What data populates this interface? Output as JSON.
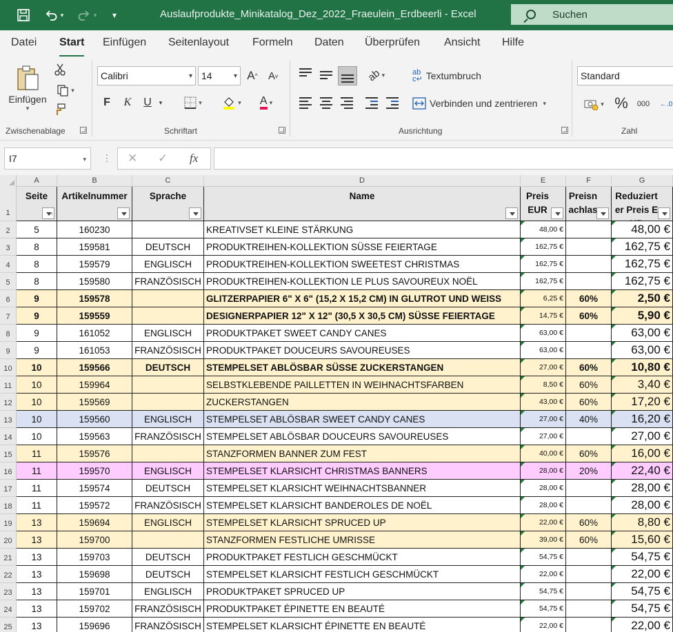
{
  "window": {
    "title": "Auslaufprodukte_Minikatalog_Dez_2022_Fraeulein_Erdbeerli  -  Excel",
    "search_label": "Suchen"
  },
  "menu": {
    "tabs": [
      "Datei",
      "Start",
      "Einfügen",
      "Seitenlayout",
      "Formeln",
      "Daten",
      "Überprüfen",
      "Ansicht",
      "Hilfe"
    ],
    "active": "Start"
  },
  "ribbon": {
    "clipboard": {
      "paste_label": "Einfügen",
      "group_label": "Zwischenablage"
    },
    "font": {
      "name": "Calibri",
      "size": "14",
      "bold": "F",
      "italic": "K",
      "underline": "U",
      "group_label": "Schriftart"
    },
    "alignment": {
      "wrap_label": "Textumbruch",
      "merge_label": "Verbinden und zentrieren",
      "group_label": "Ausrichtung"
    },
    "number": {
      "format": "Standard",
      "percent": "%",
      "thousands": "000",
      "group_label": "Zahl"
    }
  },
  "formula_bar": {
    "name_box": "I7",
    "fx": "fx",
    "formula": ""
  },
  "colors": {
    "excel_green": "#217346",
    "row_orange": "#fff2cc",
    "row_blue": "#d9e1f2",
    "row_pink": "#ffccff",
    "header_grey": "#e7e6e6"
  },
  "sheet": {
    "columns": [
      "A",
      "B",
      "C",
      "D",
      "E",
      "F",
      "G"
    ],
    "headers": {
      "seite": "Seite",
      "artikelnummer": "Artikelnummer",
      "sprache": "Sprache",
      "name": "Name",
      "preis": "Preis EUR",
      "preisnachlass": "Preisnachlass",
      "reduziert": "Reduzierter Preis EUR"
    },
    "rows": [
      {
        "row": "2",
        "seite": "5",
        "artikel": "160230",
        "sprache": "",
        "name": "KREATIVSET KLEINE STÄRKUNG",
        "preis": "48,00 €",
        "nachlass": "",
        "reduziert": "48,00 €",
        "hl": "",
        "bold": false
      },
      {
        "row": "3",
        "seite": "8",
        "artikel": "159581",
        "sprache": "DEUTSCH",
        "name": "PRODUKTREIHEN-KOLLEKTION SÜSSE FEIERTAGE",
        "preis": "162,75 €",
        "nachlass": "",
        "reduziert": "162,75 €",
        "hl": "",
        "bold": false
      },
      {
        "row": "4",
        "seite": "8",
        "artikel": "159579",
        "sprache": "ENGLISCH",
        "name": "PRODUKTREIHEN-KOLLEKTION SWEETEST CHRISTMAS",
        "preis": "162,75 €",
        "nachlass": "",
        "reduziert": "162,75 €",
        "hl": "",
        "bold": false
      },
      {
        "row": "5",
        "seite": "8",
        "artikel": "159580",
        "sprache": "FRANZÖSISCH",
        "name": "PRODUKTREIHEN-KOLLEKTION LE PLUS SAVOUREUX NOËL",
        "preis": "162,75 €",
        "nachlass": "",
        "reduziert": "162,75 €",
        "hl": "",
        "bold": false
      },
      {
        "row": "6",
        "seite": "9",
        "artikel": "159578",
        "sprache": "",
        "name": "GLITZERPAPIER 6\" X 6\" (15,2 X 15,2 CM) IN GLUTROT UND WEISS",
        "preis": "6,25 €",
        "nachlass": "60%",
        "reduziert": "2,50 €",
        "hl": "orange",
        "bold": true
      },
      {
        "row": "7",
        "seite": "9",
        "artikel": "159559",
        "sprache": "",
        "name": "DESIGNERPAPIER 12\" X 12\" (30,5 X 30,5 CM) SÜSSE FEIERTAGE",
        "preis": "14,75 €",
        "nachlass": "60%",
        "reduziert": "5,90 €",
        "hl": "orange",
        "bold": true
      },
      {
        "row": "8",
        "seite": "9",
        "artikel": "161052",
        "sprache": "ENGLISCH",
        "name": "PRODUKTPAKET SWEET CANDY CANES",
        "preis": "63,00 €",
        "nachlass": "",
        "reduziert": "63,00 €",
        "hl": "",
        "bold": false
      },
      {
        "row": "9",
        "seite": "9",
        "artikel": "161053",
        "sprache": "FRANZÖSISCH",
        "name": "PRODUKTPAKET DOUCEURS SAVOUREUSES",
        "preis": "63,00 €",
        "nachlass": "",
        "reduziert": "63,00 €",
        "hl": "",
        "bold": false
      },
      {
        "row": "10",
        "seite": "10",
        "artikel": "159566",
        "sprache": "DEUTSCH",
        "name": "STEMPELSET ABLÖSBAR SÜSSE ZUCKERSTANGEN",
        "preis": "27,00 €",
        "nachlass": "60%",
        "reduziert": "10,80 €",
        "hl": "orange",
        "bold": true
      },
      {
        "row": "11",
        "seite": "10",
        "artikel": "159964",
        "sprache": "",
        "name": "SELBSTKLEBENDE PAILLETTEN IN WEIHNACHTSFARBEN",
        "preis": "8,50 €",
        "nachlass": "60%",
        "reduziert": "3,40 €",
        "hl": "orange",
        "bold": false
      },
      {
        "row": "12",
        "seite": "10",
        "artikel": "159569",
        "sprache": "",
        "name": "ZUCKERSTANGEN",
        "preis": "43,00 €",
        "nachlass": "60%",
        "reduziert": "17,20 €",
        "hl": "orange",
        "bold": false
      },
      {
        "row": "13",
        "seite": "10",
        "artikel": "159560",
        "sprache": "ENGLISCH",
        "name": "STEMPELSET ABLÖSBAR SWEET CANDY CANES",
        "preis": "27,00 €",
        "nachlass": "40%",
        "reduziert": "16,20 €",
        "hl": "blue",
        "bold": false
      },
      {
        "row": "14",
        "seite": "10",
        "artikel": "159563",
        "sprache": "FRANZÖSISCH",
        "name": "STEMPELSET ABLÖSBAR DOUCEURS SAVOUREUSES",
        "preis": "27,00 €",
        "nachlass": "",
        "reduziert": "27,00 €",
        "hl": "",
        "bold": false
      },
      {
        "row": "15",
        "seite": "11",
        "artikel": "159576",
        "sprache": "",
        "name": "STANZFORMEN BANNER ZUM FEST",
        "preis": "40,00 €",
        "nachlass": "60%",
        "reduziert": "16,00 €",
        "hl": "orange",
        "bold": false
      },
      {
        "row": "16",
        "seite": "11",
        "artikel": "159570",
        "sprache": "ENGLISCH",
        "name": "STEMPELSET KLARSICHT CHRISTMAS BANNERS",
        "preis": "28,00 €",
        "nachlass": "20%",
        "reduziert": "22,40 €",
        "hl": "pink",
        "bold": false
      },
      {
        "row": "17",
        "seite": "11",
        "artikel": "159574",
        "sprache": "DEUTSCH",
        "name": "STEMPELSET KLARSICHT WEIHNACHTSBANNER",
        "preis": "28,00 €",
        "nachlass": "",
        "reduziert": "28,00 €",
        "hl": "",
        "bold": false
      },
      {
        "row": "18",
        "seite": "11",
        "artikel": "159572",
        "sprache": "FRANZÖSISCH",
        "name": "STEMPELSET KLARSICHT BANDEROLES DE NOËL",
        "preis": "28,00 €",
        "nachlass": "",
        "reduziert": "28,00 €",
        "hl": "",
        "bold": false
      },
      {
        "row": "19",
        "seite": "13",
        "artikel": "159694",
        "sprache": "ENGLISCH",
        "name": "STEMPELSET KLARSICHT SPRUCED UP",
        "preis": "22,00 €",
        "nachlass": "60%",
        "reduziert": "8,80 €",
        "hl": "orange",
        "bold": false
      },
      {
        "row": "20",
        "seite": "13",
        "artikel": "159700",
        "sprache": "",
        "name": "STANZFORMEN FESTLICHE UMRISSE",
        "preis": "39,00 €",
        "nachlass": "60%",
        "reduziert": "15,60 €",
        "hl": "orange",
        "bold": false
      },
      {
        "row": "21",
        "seite": "13",
        "artikel": "159703",
        "sprache": "DEUTSCH",
        "name": "PRODUKTPAKET FESTLICH GESCHMÜCKT",
        "preis": "54,75 €",
        "nachlass": "",
        "reduziert": "54,75 €",
        "hl": "",
        "bold": false
      },
      {
        "row": "22",
        "seite": "13",
        "artikel": "159698",
        "sprache": "DEUTSCH",
        "name": "STEMPELSET KLARSICHT FESTLICH GESCHMÜCKT",
        "preis": "22,00 €",
        "nachlass": "",
        "reduziert": "22,00 €",
        "hl": "",
        "bold": false
      },
      {
        "row": "23",
        "seite": "13",
        "artikel": "159701",
        "sprache": "ENGLISCH",
        "name": "PRODUKTPAKET SPRUCED UP",
        "preis": "54,75 €",
        "nachlass": "",
        "reduziert": "54,75 €",
        "hl": "",
        "bold": false
      },
      {
        "row": "24",
        "seite": "13",
        "artikel": "159702",
        "sprache": "FRANZÖSISCH",
        "name": "PRODUKTPAKET ÉPINETTE EN BEAUTÉ",
        "preis": "54,75 €",
        "nachlass": "",
        "reduziert": "54,75 €",
        "hl": "",
        "bold": false
      },
      {
        "row": "25",
        "seite": "13",
        "artikel": "159696",
        "sprache": "FRANZÖSISCH",
        "name": "STEMPELSET KLARSICHT ÉPINETTE EN BEAUTÉ",
        "preis": "22,00 €",
        "nachlass": "",
        "reduziert": "22,00 €",
        "hl": "",
        "bold": false
      }
    ]
  }
}
